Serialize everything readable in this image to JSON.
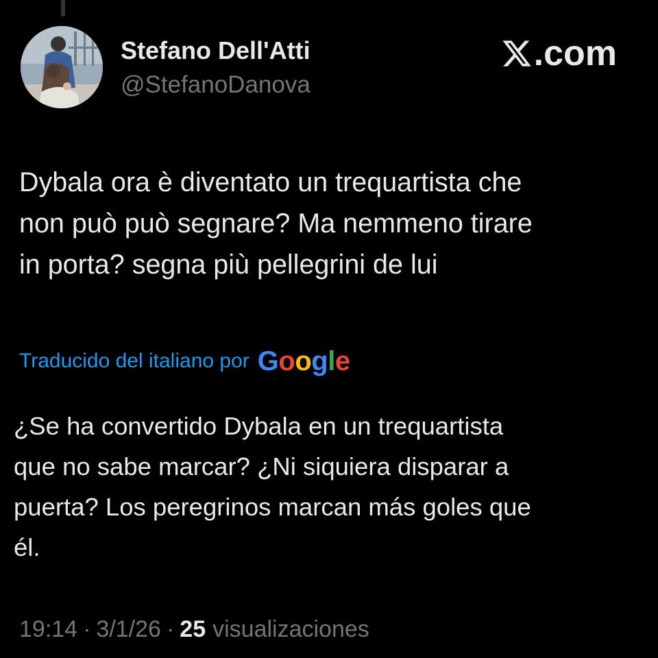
{
  "author": {
    "display_name": "Stefano Dell'Atti",
    "handle": "@StefanoDanova"
  },
  "brand": {
    "icon": "x-logo-icon",
    "suffix": ".com"
  },
  "tweet": {
    "text": "Dybala ora è diventato un trequartista che\nnon può può segnare? Ma nemmeno tirare\nin porta? segna più pellegrini de lui"
  },
  "translation": {
    "label": "Traducido del italiano por",
    "provider": {
      "letters": [
        "G",
        "o",
        "o",
        "g",
        "l",
        "e"
      ],
      "colors": [
        "#4285f4",
        "#ea4335",
        "#fbbc05",
        "#4285f4",
        "#34a853",
        "#ea4335"
      ]
    },
    "text": "¿Se ha convertido Dybala en un trequartista\nque no sabe marcar? ¿Ni siquiera disparar a\npuerta? Los peregrinos marcan más goles que\nél."
  },
  "meta": {
    "time": "19:14",
    "separator": "·",
    "date": "3/1/26",
    "views_count": "25",
    "views_label": "visualizaciones"
  },
  "colors": {
    "background": "#000000",
    "primary_text": "#e7e9ea",
    "secondary_text": "#71767b",
    "link": "#1d9bf0"
  }
}
